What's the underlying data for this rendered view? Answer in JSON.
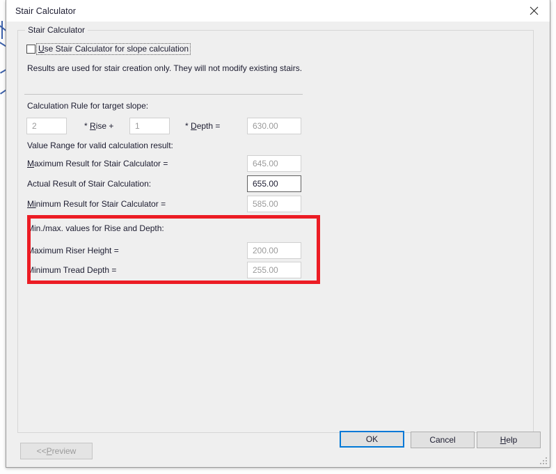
{
  "window": {
    "title": "Stair Calculator",
    "close_icon": "close-icon"
  },
  "group": {
    "legend": "Stair Calculator"
  },
  "checkbox": {
    "label_prefix": "U",
    "label_rest": "se Stair Calculator for slope  calculation",
    "checked": false
  },
  "info_text": "Results are used for stair creation only. They will not modify existing stairs.",
  "calculation_rule": {
    "heading": "Calculation Rule for target slope:",
    "rise_factor": "2",
    "rise_operator_prefix": "* ",
    "rise_operator_accel": "R",
    "rise_operator_rest": "ise +",
    "depth_factor": "1",
    "depth_operator_prefix": "* ",
    "depth_operator_accel": "D",
    "depth_operator_rest": "epth =",
    "result_value": "630.00"
  },
  "value_range": {
    "heading": "Value Range for valid calculation result:",
    "rows": [
      {
        "label_accel": "M",
        "label_rest": "aximum Result for Stair Calculator  =",
        "value": "645.00",
        "enabled": false
      },
      {
        "label_accel": "",
        "label_rest": "Actual Result of Stair Calculation:",
        "value": "655.00",
        "enabled": true
      },
      {
        "label_accel": "Mi",
        "label_rest": "nimum Result for Stair Calculator  =",
        "value": "585.00",
        "enabled": false
      }
    ]
  },
  "min_max_section": {
    "heading": "Min./max. values for Rise and Depth:",
    "rows": [
      {
        "label": "Maximum Riser Height  =",
        "value": "200.00"
      },
      {
        "label": "Minimum Tread Depth  =",
        "value": "255.00"
      }
    ],
    "highlight_color": "#ec1c24"
  },
  "buttons": {
    "preview": {
      "prefix": "<< ",
      "accel": "P",
      "rest": "review",
      "disabled": true
    },
    "ok": {
      "label": "OK",
      "is_default": true
    },
    "cancel": {
      "label": "Cancel",
      "is_default": false
    },
    "help": {
      "accel": "H",
      "rest": "elp",
      "is_default": false
    }
  },
  "colors": {
    "accent": "#0078d7",
    "highlight": "#ec1c24",
    "dialog_bg": "#efefef",
    "disabled_text": "#9a9a9a"
  }
}
